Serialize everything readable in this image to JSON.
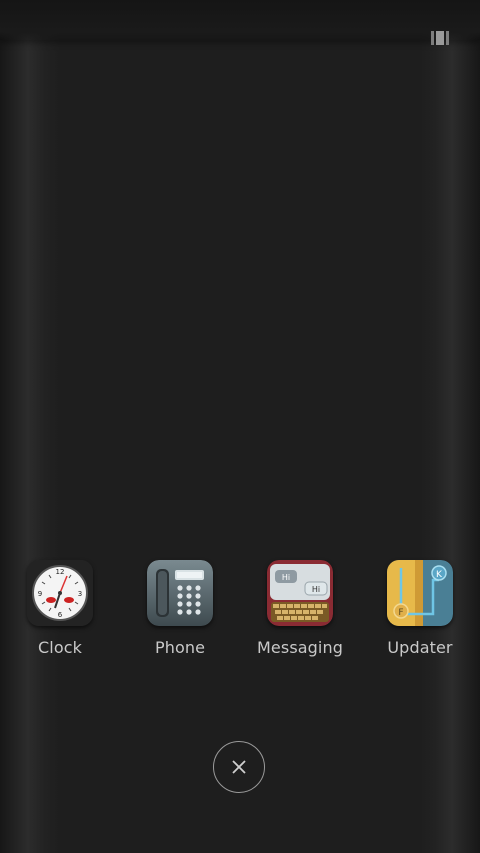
{
  "apps": [
    {
      "label": "Clock",
      "icon": "clock-icon"
    },
    {
      "label": "Phone",
      "icon": "phone-icon"
    },
    {
      "label": "Messaging",
      "icon": "messaging-icon"
    },
    {
      "label": "Updater",
      "icon": "updater-icon"
    }
  ],
  "messaging_bubbles": [
    "Hi",
    "Hi"
  ],
  "updater_letters": [
    "K",
    "F"
  ],
  "close_button": {
    "icon": "close-icon"
  },
  "colors": {
    "background": "#1e1e1e",
    "label": "#c9c9c9"
  }
}
